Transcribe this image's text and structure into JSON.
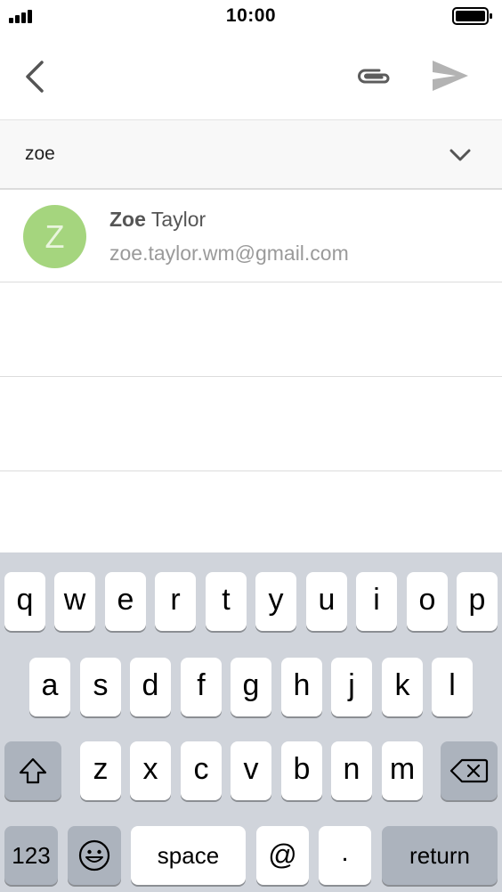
{
  "status_bar": {
    "time": "10:00"
  },
  "toolbar": {
    "back_icon": "chevron-left-icon",
    "attach_icon": "paperclip-icon",
    "send_icon": "send-icon"
  },
  "recipient": {
    "value": "zoe",
    "expand_icon": "chevron-down-icon"
  },
  "suggestion": {
    "avatar_initial": "Z",
    "avatar_color": "#a5d57e",
    "name_match": "Zoe",
    "name_rest": " Taylor",
    "email": "zoe.taylor.wm@gmail.com"
  },
  "keyboard": {
    "row1": [
      "q",
      "w",
      "e",
      "r",
      "t",
      "y",
      "u",
      "i",
      "o",
      "p"
    ],
    "row2": [
      "a",
      "s",
      "d",
      "f",
      "g",
      "h",
      "j",
      "k",
      "l"
    ],
    "row3": [
      "z",
      "x",
      "c",
      "v",
      "b",
      "n",
      "m"
    ],
    "shift_icon": "shift-icon",
    "delete_icon": "backspace-icon",
    "numbers_label": "123",
    "emoji_icon": "emoji-icon",
    "space_label": "space",
    "at_label": "@",
    "dot_label": ".",
    "return_label": "return"
  }
}
